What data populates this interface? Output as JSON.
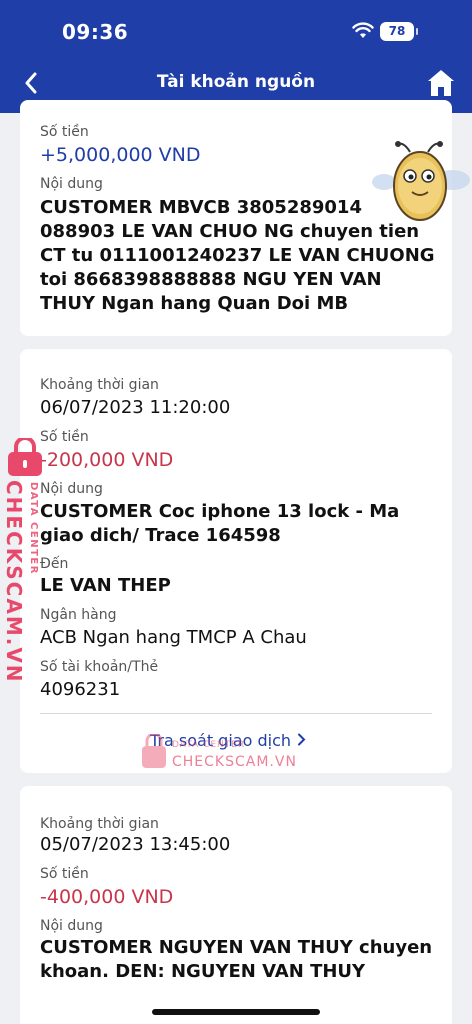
{
  "status_bar": {
    "time": "09:36",
    "battery": "78"
  },
  "header": {
    "title": "Tài khoản nguồn"
  },
  "transactions": [
    {
      "amount_label": "Số tiền",
      "amount": "+5,000,000 VND",
      "content_label": "Nội dung",
      "content": "CUSTOMER MBVCB 3805289014 088903 LE VAN CHUO NG chuyen tien CT tu 0111001240237  LE VAN CHUONG toi 8668398888888 NGU YEN VAN THUY Ngan hang Quan Doi  MB"
    },
    {
      "time_label": "Khoảng thời gian",
      "time": "06/07/2023 11:20:00",
      "amount_label": "Số tiền",
      "amount": "-200,000 VND",
      "content_label": "Nội dung",
      "content": "CUSTOMER Coc iphone 13 lock - Ma giao dich/  Trace 164598",
      "to_label": "Đến",
      "to": "LE VAN THEP",
      "bank_label": "Ngân hàng",
      "bank": "ACB Ngan hang TMCP A Chau",
      "account_label": "Số tài khoản/Thẻ",
      "account": "4096231",
      "trace_link": "Tra soát giao dịch"
    },
    {
      "time_label": "Khoảng thời gian",
      "time": "05/07/2023 13:45:00",
      "amount_label": "Số tiền",
      "amount": "-400,000 VND",
      "content_label": "Nội dung",
      "content": "CUSTOMER NGUYEN VAN THUY chuyen khoan. DEN: NGUYEN VAN THUY"
    }
  ],
  "watermark": {
    "name": "CHECKSCAM.VN",
    "sub": "DATA CENTER"
  },
  "colors": {
    "header": "#1f3ea8",
    "positive": "#1f3ea8",
    "negative": "#c8364b",
    "watermark": "#e8496b"
  }
}
